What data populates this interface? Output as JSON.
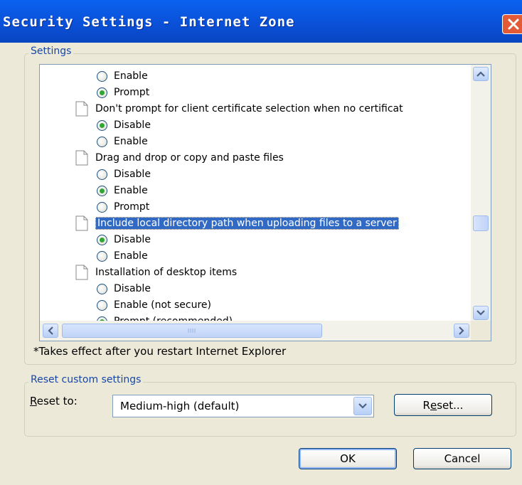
{
  "window": {
    "title": "Security Settings - Internet Zone"
  },
  "settings_group": {
    "title": "Settings",
    "items": [
      {
        "kind": "radio",
        "label": "Enable",
        "checked": false
      },
      {
        "kind": "radio",
        "label": "Prompt",
        "checked": true
      },
      {
        "kind": "category",
        "label": "Don't prompt for client certificate selection when no certificat"
      },
      {
        "kind": "radio",
        "label": "Disable",
        "checked": true
      },
      {
        "kind": "radio",
        "label": "Enable",
        "checked": false
      },
      {
        "kind": "category",
        "label": "Drag and drop or copy and paste files"
      },
      {
        "kind": "radio",
        "label": "Disable",
        "checked": false
      },
      {
        "kind": "radio",
        "label": "Enable",
        "checked": true
      },
      {
        "kind": "radio",
        "label": "Prompt",
        "checked": false
      },
      {
        "kind": "category",
        "label": "Include local directory path when uploading files to a server",
        "selected": true
      },
      {
        "kind": "radio",
        "label": "Disable",
        "checked": true
      },
      {
        "kind": "radio",
        "label": "Enable",
        "checked": false
      },
      {
        "kind": "category",
        "label": "Installation of desktop items"
      },
      {
        "kind": "radio",
        "label": "Disable",
        "checked": false
      },
      {
        "kind": "radio",
        "label": "Enable (not secure)",
        "checked": false
      },
      {
        "kind": "radio",
        "label": "Prompt (recommended)",
        "checked": true
      }
    ],
    "note": "*Takes effect after you restart Internet Explorer"
  },
  "reset_group": {
    "title": "Reset custom settings",
    "label_prefix": "R",
    "label_rest": "eset to:",
    "selected_value": "Medium-high (default)",
    "reset_button_a": "R",
    "reset_button_u": "e",
    "reset_button_b": "set..."
  },
  "buttons": {
    "ok": "OK",
    "cancel": "Cancel"
  },
  "colors": {
    "titlebar": "#0a4fd6",
    "selection": "#316ac5",
    "radio_checked": "#31a634",
    "group_title": "#1747a6"
  }
}
